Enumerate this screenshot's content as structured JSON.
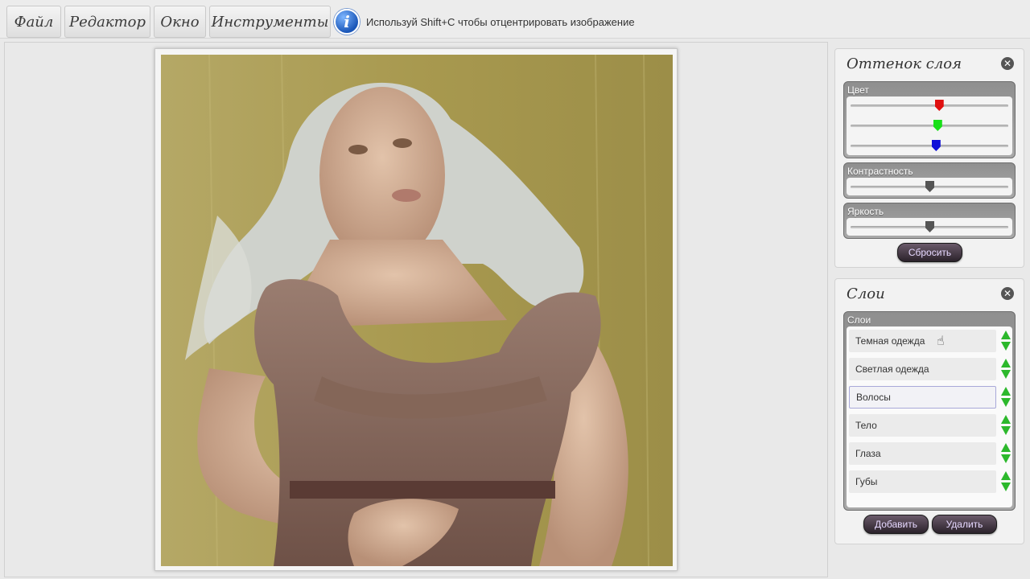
{
  "menu": {
    "file": "Файл",
    "editor": "Редактор",
    "window": "Окно",
    "tools": "Инструменты"
  },
  "info": {
    "icon_label": "i",
    "message": "Используй Shift+C чтобы отцентрировать изображение"
  },
  "hue_panel": {
    "title": "Оттенок слоя",
    "color_group_label": "Цвет",
    "color_sliders": [
      {
        "name": "red",
        "color": "#e01010",
        "value": 0.56
      },
      {
        "name": "green",
        "color": "#18e018",
        "value": 0.55
      },
      {
        "name": "blue",
        "color": "#1010d8",
        "value": 0.54
      }
    ],
    "contrast_label": "Контрастность",
    "contrast_value": 0.5,
    "brightness_label": "Яркость",
    "brightness_value": 0.5,
    "reset_button": "Сбросить"
  },
  "layers_panel": {
    "title": "Слои",
    "group_label": "Слои",
    "layers": [
      "Темная одежда",
      "Светлая одежда",
      "Волосы",
      "Тело",
      "Глаза",
      "Губы"
    ],
    "selected_index": 2,
    "add_button": "Добавить",
    "delete_button": "Удалить"
  },
  "colors": {
    "accent_arrow": "#2cb82c",
    "button_text": "#e6d8ff",
    "wood_background": "#a89a58",
    "dress": "#8a6e62"
  }
}
